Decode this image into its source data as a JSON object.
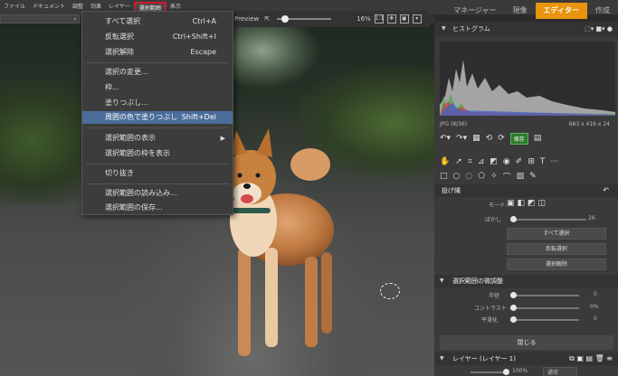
{
  "menubar": {
    "items": [
      "ファイル",
      "ドキュメント",
      "調整",
      "効果",
      "レイヤー",
      "選択範囲",
      "表示"
    ],
    "active_index": 5
  },
  "modes": [
    "マネージャー",
    "現像",
    "エディター",
    "作成"
  ],
  "zoom": {
    "preview_label": "Preview",
    "percent": "16%",
    "level": 0.16
  },
  "dropdown": {
    "items": [
      {
        "label": "すべて選択",
        "shortcut": "Ctrl+A"
      },
      {
        "label": "反転選択",
        "shortcut": "Ctrl+Shift+I"
      },
      {
        "label": "選択解除",
        "shortcut": "Escape"
      },
      {
        "label": "選択の変更...",
        "shortcut": ""
      },
      {
        "label": "枠...",
        "shortcut": ""
      },
      {
        "label": "塗りつぶし...",
        "shortcut": ""
      },
      {
        "label": "周囲の色で塗りつぶし",
        "shortcut": "Shift+Del"
      },
      {
        "label": "選択範囲の表示",
        "shortcut": ""
      },
      {
        "label": "選択範囲の枠を表示",
        "shortcut": ""
      },
      {
        "label": "切り抜き",
        "shortcut": ""
      },
      {
        "label": "選択範囲の読み込み...",
        "shortcut": ""
      },
      {
        "label": "選択範囲の保存...",
        "shortcut": ""
      }
    ],
    "highlighted_index": 6
  },
  "panel": {
    "histogram_title": "ヒストグラム",
    "file_info": "JPG (8/36)",
    "dimensions": "683 x 416 x 24",
    "save_label": "保存",
    "lasso_title": "投げ縄",
    "mode_label": "モード:",
    "blur_label": "ぼかし",
    "blur_value": "26",
    "blur_level": 0.26,
    "select_all": "すべて選択",
    "invert": "反転選択",
    "deselect": "選択解除",
    "refine_title": "選択範囲の微調整",
    "radius_label": "半径",
    "radius_value": "0",
    "contrast_label": "コントラスト",
    "contrast_value": "0%",
    "smooth_label": "平滑化",
    "smooth_value": "0",
    "close_label": "閉じる",
    "layer_title": "レイヤー (レイヤー 1)",
    "opacity_value": "100%",
    "blend_mode": "通常"
  }
}
